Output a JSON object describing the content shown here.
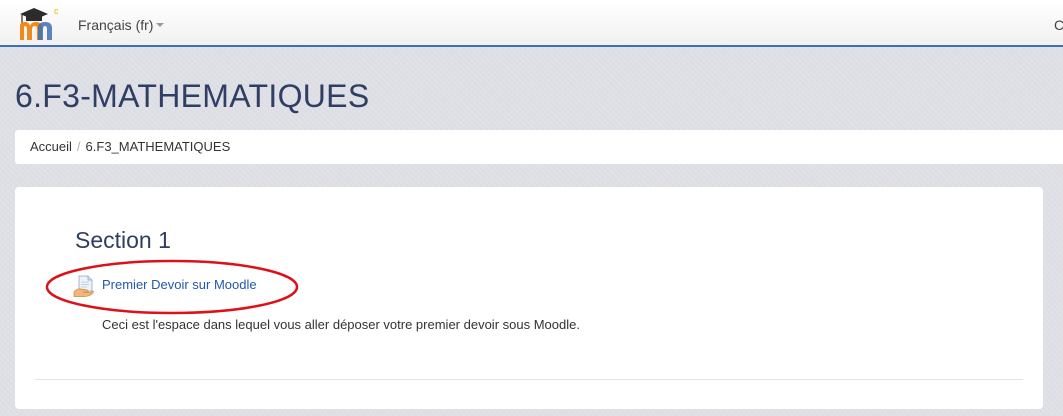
{
  "navbar": {
    "language_label": "Français (fr)",
    "right_label": "C"
  },
  "header": {
    "title": "6.F3-MATHEMATIQUES"
  },
  "breadcrumb": {
    "home": "Accueil",
    "separator": "/",
    "current": "6.F3_MATHEMATIQUES"
  },
  "section": {
    "title": "Section 1",
    "activity": {
      "icon": "assignment-icon",
      "label": "Premier Devoir sur Moodle",
      "description": "Ceci est l'espace dans lequel vous aller déposer votre premier devoir sous Moodle."
    }
  },
  "colors": {
    "navbar_border": "#3f6fb3",
    "title_text": "#2f3e63",
    "link": "#2458a8",
    "highlight_annotation": "#e0101a"
  }
}
